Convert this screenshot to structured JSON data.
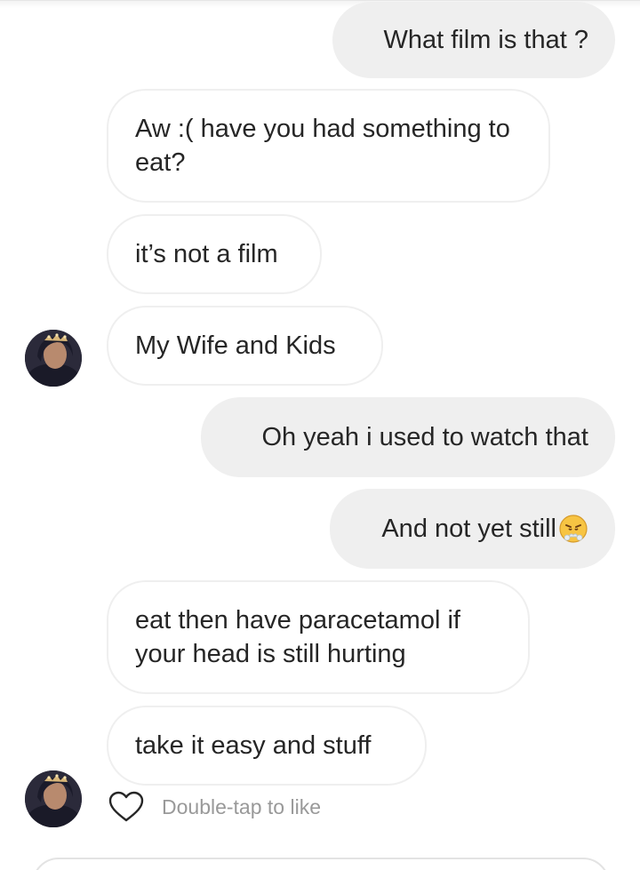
{
  "messages": [
    {
      "side": "out",
      "text": "What film is that ?"
    },
    {
      "side": "in",
      "text": "Aw :( have you had something to eat?"
    },
    {
      "side": "in",
      "text": "it’s not a film"
    },
    {
      "side": "in",
      "text": "My Wife and Kids"
    },
    {
      "side": "out",
      "text": "Oh yeah i used to watch that"
    },
    {
      "side": "out",
      "text": "And not yet still",
      "emoji": "face-with-steam-from-nose-emoji"
    },
    {
      "side": "in",
      "text": "eat then have paracetamol if your head is still hurting"
    },
    {
      "side": "in",
      "text": "take it easy and stuff"
    }
  ],
  "like_hint": "Double-tap to like",
  "icons": {
    "like": "heart-outline-icon",
    "avatar": "contact-avatar"
  },
  "colors": {
    "incoming_bg": "#ffffff",
    "incoming_border": "#efefef",
    "outgoing_bg": "#efefef",
    "text": "#262626",
    "hint": "#999999"
  }
}
